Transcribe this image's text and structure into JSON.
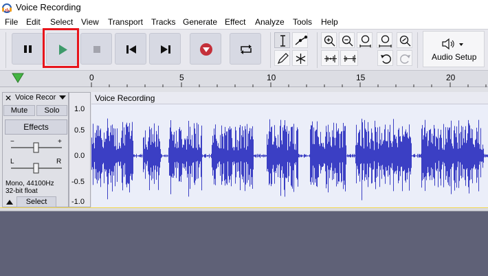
{
  "window": {
    "title": "Voice Recording"
  },
  "menu": [
    "File",
    "Edit",
    "Select",
    "View",
    "Transport",
    "Tracks",
    "Generate",
    "Effect",
    "Analyze",
    "Tools",
    "Help"
  ],
  "transport": {
    "buttons": [
      {
        "name": "pause-button",
        "icon": "pause-icon"
      },
      {
        "name": "play-button",
        "icon": "play-icon"
      },
      {
        "name": "stop-button",
        "icon": "stop-icon"
      },
      {
        "name": "skip-to-start-button",
        "icon": "skip-start-icon"
      },
      {
        "name": "skip-to-end-button",
        "icon": "skip-end-icon"
      },
      {
        "name": "record-button",
        "icon": "record-icon"
      },
      {
        "name": "loop-button",
        "icon": "loop-icon"
      }
    ]
  },
  "tools": {
    "items": [
      "selection-tool",
      "envelope-tool",
      "draw-tool",
      "multi-tool"
    ],
    "zoom": [
      "zoom-in",
      "zoom-out",
      "fit-selection",
      "fit-project",
      "zoom-toggle",
      "trim-outside",
      "silence-selection",
      "undo",
      "redo"
    ]
  },
  "audio_setup": {
    "label": "Audio Setup"
  },
  "ruler": {
    "ticks": [
      "0",
      "5",
      "10",
      "15",
      "20"
    ]
  },
  "track": {
    "name": "Voice Recor",
    "mute_label": "Mute",
    "solo_label": "Solo",
    "effects_label": "Effects",
    "gain_minus": "−",
    "gain_plus": "+",
    "pan_left": "L",
    "pan_right": "R",
    "format_line1": "Mono, 44100Hz",
    "format_line2": "32-bit float",
    "select_label": "Select",
    "scale": [
      "1.0",
      "0.5",
      "0.0",
      "-0.5",
      "-1.0"
    ],
    "clip_title": "Voice Recording"
  },
  "colors": {
    "waveform": "#3b3fc4",
    "highlight": "#e8141b",
    "play": "#3e9a6a",
    "record": "#c4303a"
  }
}
